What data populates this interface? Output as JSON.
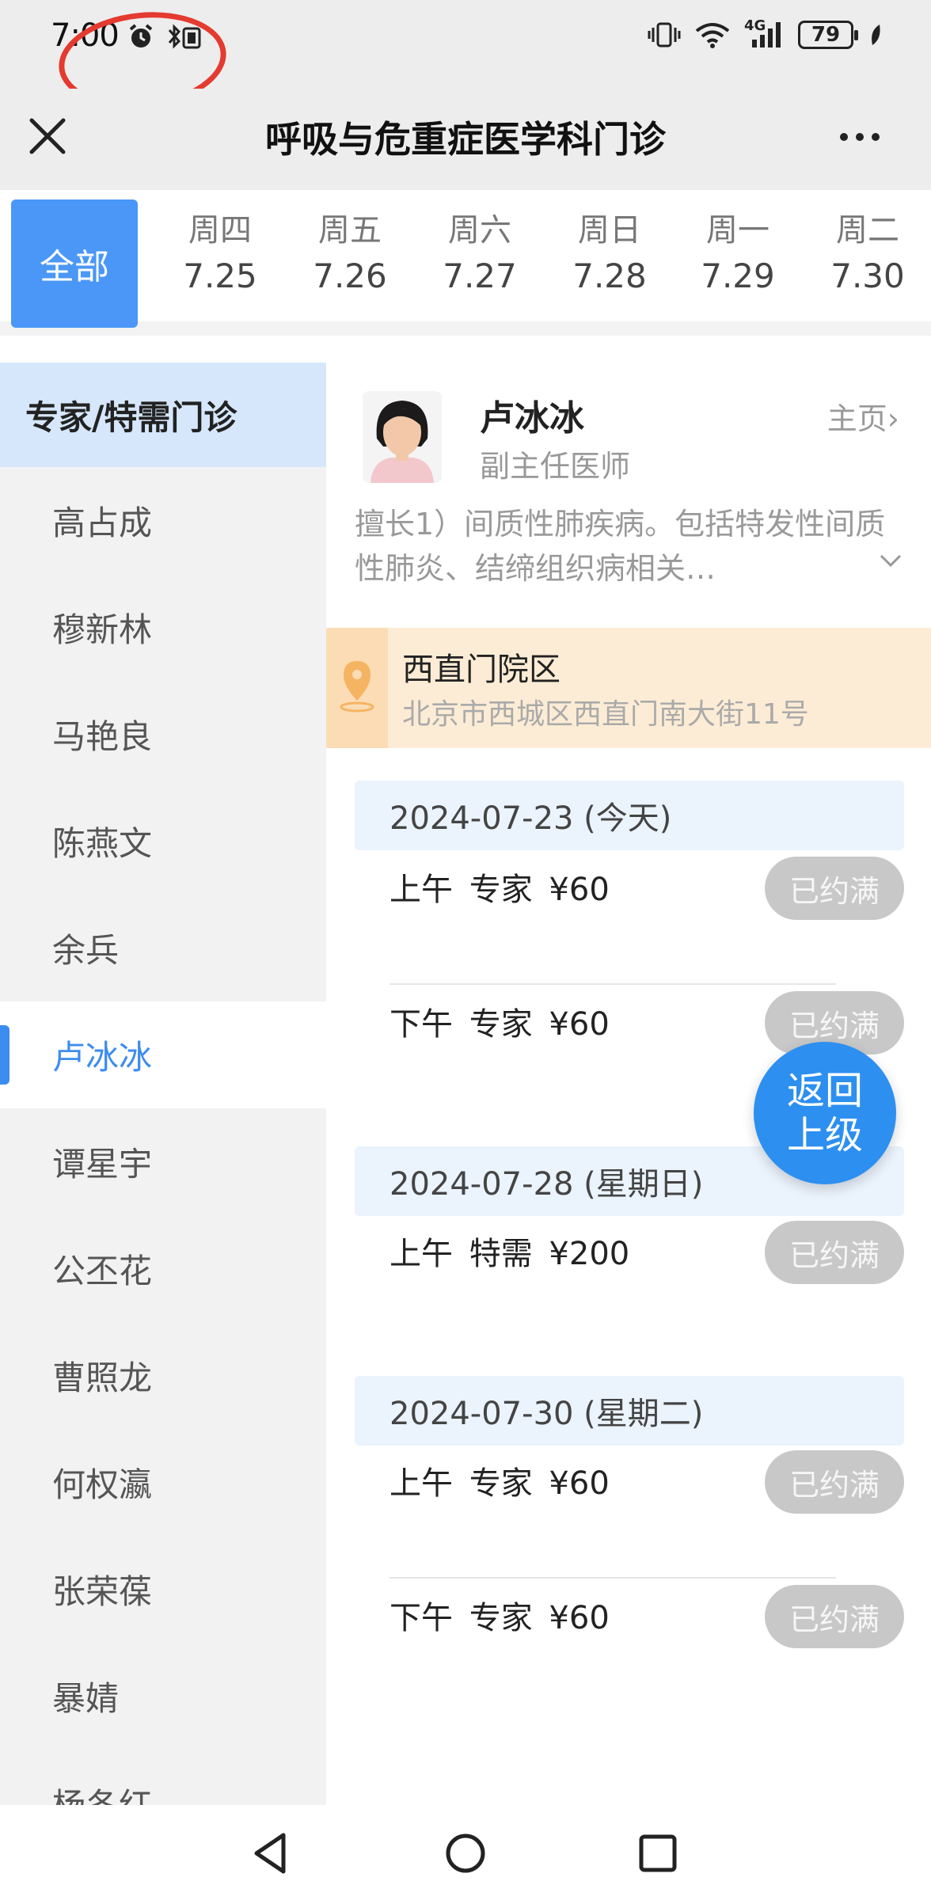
{
  "status": {
    "time": "7:00",
    "battery": "79",
    "network": "4G"
  },
  "header": {
    "title": "呼吸与危重症医学科门诊"
  },
  "date_tabs": {
    "all_label": "全部",
    "days": [
      {
        "weekday": "周四",
        "date": "7.25"
      },
      {
        "weekday": "周五",
        "date": "7.26"
      },
      {
        "weekday": "周六",
        "date": "7.27"
      },
      {
        "weekday": "周日",
        "date": "7.28"
      },
      {
        "weekday": "周一",
        "date": "7.29"
      },
      {
        "weekday": "周二",
        "date": "7.30"
      }
    ]
  },
  "sidebar": {
    "header": "专家/特需门诊",
    "doctors": [
      "高占成",
      "穆新林",
      "马艳良",
      "陈燕文",
      "余兵",
      "卢冰冰",
      "谭星宇",
      "公丕花",
      "曹照龙",
      "何权瀛",
      "张荣葆",
      "暴婧",
      "杨冬红"
    ],
    "active_index": 5
  },
  "doctor": {
    "name": "卢冰冰",
    "title": "副主任医师",
    "home_link": "主页›",
    "expertise": "擅长1）间质性肺疾病。包括特发性间质性肺炎、结缔组织病相关…"
  },
  "campus": {
    "name": "西直门院区",
    "address": "北京市西城区西直门南大街11号"
  },
  "schedule": {
    "days": [
      {
        "date": "2024-07-23 (今天)",
        "slots": [
          {
            "label": "上午 专家 ¥60",
            "status": "已约满"
          },
          {
            "label": "下午 专家 ¥60",
            "status": "已约满"
          }
        ]
      },
      {
        "date": "2024-07-28 (星期日)",
        "slots": [
          {
            "label": "上午 特需 ¥200",
            "status": "已约满"
          }
        ]
      },
      {
        "date": "2024-07-30 (星期二)",
        "slots": [
          {
            "label": "上午 专家 ¥60",
            "status": "已约满"
          },
          {
            "label": "下午 专家 ¥60",
            "status": "已约满"
          }
        ]
      }
    ]
  },
  "back_button": {
    "line1": "返回",
    "line2": "上级"
  },
  "colors": {
    "accent": "#4a97f7",
    "annotation": "#e43a2f"
  }
}
